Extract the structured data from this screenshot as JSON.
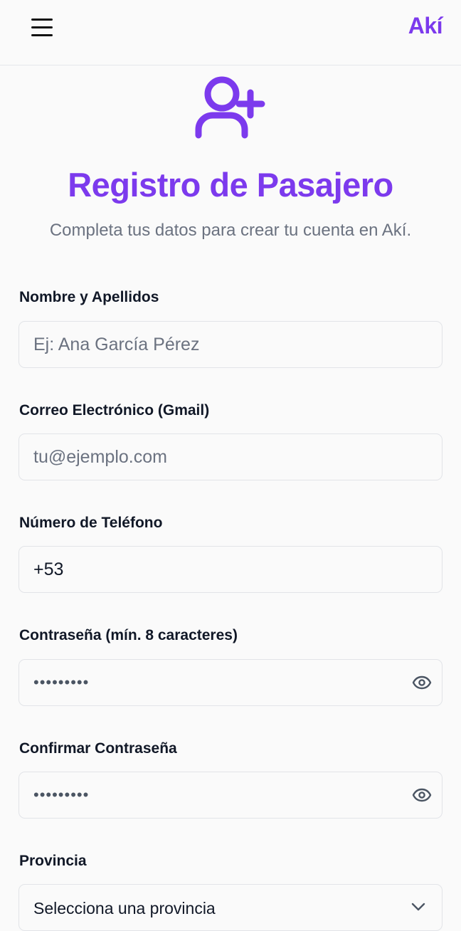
{
  "header": {
    "brand": "Akí",
    "menu_icon": "hamburger-menu-icon"
  },
  "hero": {
    "icon": "user-plus-icon",
    "icon_color": "#7c3aed",
    "title": "Registro de Pasajero",
    "subtitle": "Completa tus datos para crear tu cuenta en Akí."
  },
  "form": {
    "name": {
      "label": "Nombre y Apellidos",
      "placeholder": "Ej: Ana García Pérez",
      "value": ""
    },
    "email": {
      "label": "Correo Electrónico (Gmail)",
      "placeholder": "tu@ejemplo.com",
      "value": ""
    },
    "phone": {
      "label": "Número de Teléfono",
      "value": "+53"
    },
    "password": {
      "label": "Contraseña (mín. 8 caracteres)",
      "value": "•••••••••",
      "toggle_icon": "eye-icon"
    },
    "confirm": {
      "label": "Confirmar Contraseña",
      "value": "•••••••••",
      "toggle_icon": "eye-icon"
    },
    "province": {
      "label": "Provincia",
      "selected": "Selecciona una provincia",
      "icon": "chevron-down-icon"
    }
  },
  "colors": {
    "accent": "#7c3aed",
    "muted_text": "#6b7280",
    "border": "#e2e4e8",
    "background": "#fafafa"
  }
}
